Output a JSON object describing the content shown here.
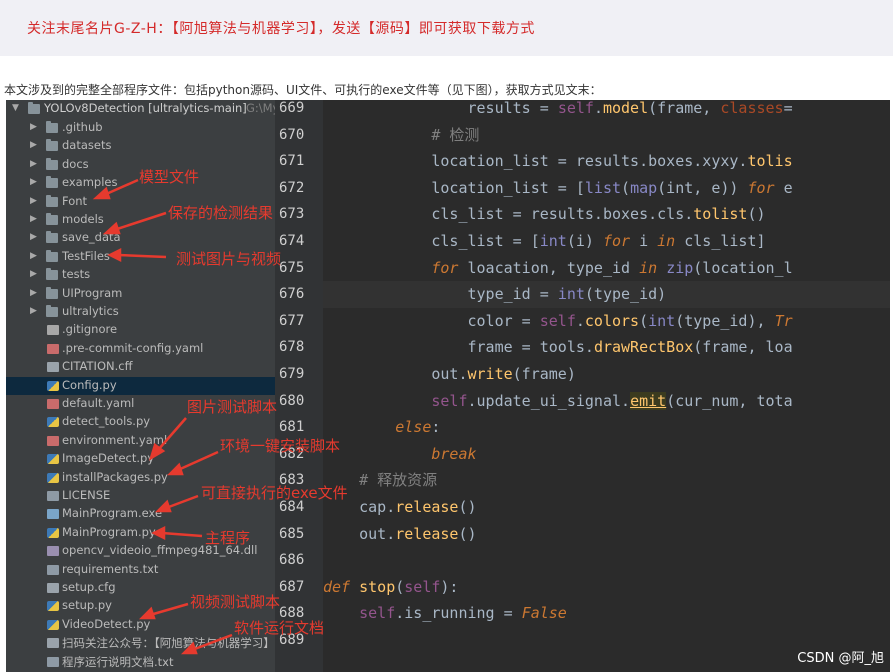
{
  "banner": {
    "text": "关注末尾名片G-Z-H：【阿旭算法与机器学习】，发送【源码】即可获取下载方式"
  },
  "intro": {
    "text": "本文涉及到的完整全部程序文件：包括python源码、UI文件、可执行的exe文件等（见下图），获取方式见文末："
  },
  "tree": {
    "root": {
      "name": "YOLOv8Detection [ultralytics-main]",
      "path": "G:\\My"
    },
    "items": [
      {
        "label": ".github",
        "kind": "folder"
      },
      {
        "label": "datasets",
        "kind": "folder"
      },
      {
        "label": "docs",
        "kind": "folder"
      },
      {
        "label": "examples",
        "kind": "folder"
      },
      {
        "label": "Font",
        "kind": "folder"
      },
      {
        "label": "models",
        "kind": "folder"
      },
      {
        "label": "save_data",
        "kind": "folder"
      },
      {
        "label": "TestFiles",
        "kind": "folder"
      },
      {
        "label": "tests",
        "kind": "folder"
      },
      {
        "label": "UIProgram",
        "kind": "folder"
      },
      {
        "label": "ultralytics",
        "kind": "folder"
      },
      {
        "label": ".gitignore",
        "kind": "ign"
      },
      {
        "label": ".pre-commit-config.yaml",
        "kind": "yaml"
      },
      {
        "label": "CITATION.cff",
        "kind": "cfg"
      },
      {
        "label": "Config.py",
        "kind": "py"
      },
      {
        "label": "default.yaml",
        "kind": "yaml"
      },
      {
        "label": "detect_tools.py",
        "kind": "py"
      },
      {
        "label": "environment.yaml",
        "kind": "yaml"
      },
      {
        "label": "ImageDetect.py",
        "kind": "py"
      },
      {
        "label": "installPackages.py",
        "kind": "py"
      },
      {
        "label": "LICENSE",
        "kind": "txt"
      },
      {
        "label": "MainProgram.exe",
        "kind": "exe"
      },
      {
        "label": "MainProgram.py",
        "kind": "py"
      },
      {
        "label": "opencv_videoio_ffmpeg481_64.dll",
        "kind": "dll"
      },
      {
        "label": "requirements.txt",
        "kind": "txt"
      },
      {
        "label": "setup.cfg",
        "kind": "cfg"
      },
      {
        "label": "setup.py",
        "kind": "py"
      },
      {
        "label": "VideoDetect.py",
        "kind": "py"
      },
      {
        "label": "扫码关注公众号：【阿旭算法与机器学习】",
        "kind": "img"
      },
      {
        "label": "程序运行说明文档.txt",
        "kind": "txt"
      }
    ]
  },
  "annotations": {
    "models": "模型文件",
    "save_data": "保存的检测结果",
    "testfiles": "测试图片与视频",
    "image_detect": "图片测试脚本",
    "install": "环境一键安装脚本",
    "exe": "可直接执行的exe文件",
    "main": "主程序",
    "video": "视频测试脚本",
    "doc": "软件运行文档"
  },
  "editor": {
    "line_numbers": [
      "669",
      "670",
      "671",
      "672",
      "673",
      "674",
      "675",
      "676",
      "677",
      "678",
      "679",
      "680",
      "681",
      "682",
      "683",
      "684",
      "685",
      "686",
      "687",
      "688",
      "689"
    ],
    "lines": [
      "                results = self.model(frame, classes=",
      "            # 检测",
      "            location_list = results.boxes.xyxy.tolis",
      "            location_list = [list(map(int, e)) for e",
      "            cls_list = results.boxes.cls.tolist()",
      "            cls_list = [int(i) for i in cls_list]",
      "            for loacation, type_id in zip(location_l",
      "                type_id = int(type_id)",
      "                color = self.colors(int(type_id), Tr",
      "                frame = tools.drawRectBox(frame, loa",
      "            out.write(frame)",
      "            self.update_ui_signal.emit(cur_num, tota",
      "        else:",
      "            break",
      "    # 释放资源",
      "    cap.release()",
      "    out.release()",
      "",
      "def stop(self):",
      "    self.is_running = False",
      ""
    ]
  },
  "footer": {
    "watermark": "CSDN @阿_旭"
  }
}
